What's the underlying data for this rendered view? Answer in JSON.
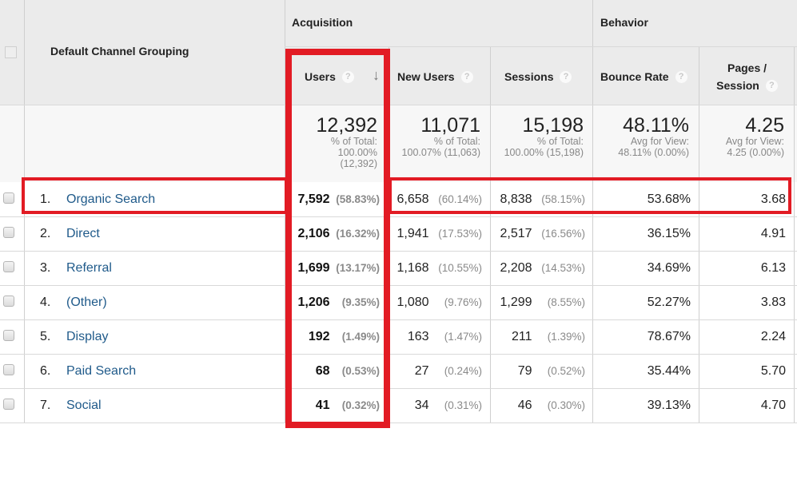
{
  "header": {
    "dimension_label": "Default Channel Grouping",
    "groups": {
      "acquisition": "Acquisition",
      "behavior": "Behavior"
    },
    "columns": {
      "users": "Users",
      "new_users": "New Users",
      "sessions": "Sessions",
      "bounce_rate": "Bounce Rate",
      "pages_session_line1": "Pages /",
      "pages_session_line2": "Session"
    },
    "help_glyph": "?",
    "sort_glyph": "↓"
  },
  "totals": {
    "users": {
      "value": "12,392",
      "sub1": "% of Total:",
      "sub2": "100.00%",
      "sub3": "(12,392)"
    },
    "new_users": {
      "value": "11,071",
      "sub1": "% of Total:",
      "sub2": "100.07% (11,063)"
    },
    "sessions": {
      "value": "15,198",
      "sub1": "% of Total:",
      "sub2": "100.00% (15,198)"
    },
    "bounce_rate": {
      "value": "48.11%",
      "sub1": "Avg for View:",
      "sub2": "48.11% (0.00%)"
    },
    "pages_session": {
      "value": "4.25",
      "sub1": "Avg for View:",
      "sub2": "4.25 (0.00%)"
    }
  },
  "rows": [
    {
      "index": "1.",
      "channel": "Organic Search",
      "users": "7,592",
      "users_pct": "(58.83%)",
      "new_users": "6,658",
      "new_users_pct": "(60.14%)",
      "sessions": "8,838",
      "sessions_pct": "(58.15%)",
      "bounce_rate": "53.68%",
      "pages_session": "3.68"
    },
    {
      "index": "2.",
      "channel": "Direct",
      "users": "2,106",
      "users_pct": "(16.32%)",
      "new_users": "1,941",
      "new_users_pct": "(17.53%)",
      "sessions": "2,517",
      "sessions_pct": "(16.56%)",
      "bounce_rate": "36.15%",
      "pages_session": "4.91"
    },
    {
      "index": "3.",
      "channel": "Referral",
      "users": "1,699",
      "users_pct": "(13.17%)",
      "new_users": "1,168",
      "new_users_pct": "(10.55%)",
      "sessions": "2,208",
      "sessions_pct": "(14.53%)",
      "bounce_rate": "34.69%",
      "pages_session": "6.13"
    },
    {
      "index": "4.",
      "channel": "(Other)",
      "users": "1,206",
      "users_pct": "(9.35%)",
      "new_users": "1,080",
      "new_users_pct": "(9.76%)",
      "sessions": "1,299",
      "sessions_pct": "(8.55%)",
      "bounce_rate": "52.27%",
      "pages_session": "3.83"
    },
    {
      "index": "5.",
      "channel": "Display",
      "users": "192",
      "users_pct": "(1.49%)",
      "new_users": "163",
      "new_users_pct": "(1.47%)",
      "sessions": "211",
      "sessions_pct": "(1.39%)",
      "bounce_rate": "78.67%",
      "pages_session": "2.24"
    },
    {
      "index": "6.",
      "channel": "Paid Search",
      "users": "68",
      "users_pct": "(0.53%)",
      "new_users": "27",
      "new_users_pct": "(0.24%)",
      "sessions": "79",
      "sessions_pct": "(0.52%)",
      "bounce_rate": "35.44%",
      "pages_session": "5.70"
    },
    {
      "index": "7.",
      "channel": "Social",
      "users": "41",
      "users_pct": "(0.32%)",
      "new_users": "34",
      "new_users_pct": "(0.31%)",
      "sessions": "46",
      "sessions_pct": "(0.30%)",
      "bounce_rate": "39.13%",
      "pages_session": "4.70"
    }
  ],
  "highlight_color": "#e21b24",
  "link_color": "#1f5a8a"
}
